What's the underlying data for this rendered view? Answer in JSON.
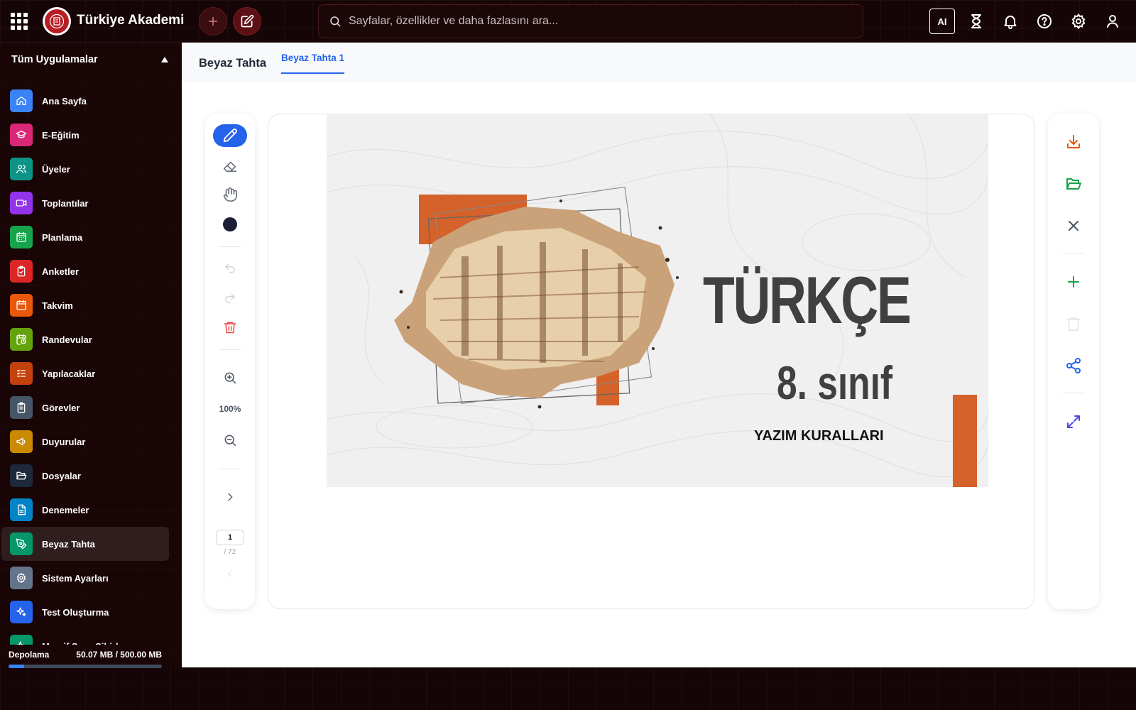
{
  "app": {
    "brand": "Türkiye Akademi"
  },
  "search": {
    "placeholder": "Sayfalar, özellikler ve daha fazlasını ara..."
  },
  "topbar": {
    "ai_label": "AI",
    "icons": [
      "hourglass-icon",
      "bell-icon",
      "help-icon",
      "settings-icon",
      "user-icon"
    ]
  },
  "sidebar": {
    "header": "Tüm Uygulamalar",
    "items": [
      {
        "label": "Ana Sayfa",
        "icon": "home-icon",
        "color": "#3b82f6"
      },
      {
        "label": "E-Eğitim",
        "icon": "graduation-cap-icon",
        "color": "#db2777"
      },
      {
        "label": "Üyeler",
        "icon": "users-icon",
        "color": "#0d9488"
      },
      {
        "label": "Toplantılar",
        "icon": "video-icon",
        "color": "#9333ea"
      },
      {
        "label": "Planlama",
        "icon": "calendar-grid-icon",
        "color": "#16a34a"
      },
      {
        "label": "Anketler",
        "icon": "clipboard-check-icon",
        "color": "#dc2626"
      },
      {
        "label": "Takvim",
        "icon": "calendar-icon",
        "color": "#ea580c"
      },
      {
        "label": "Randevular",
        "icon": "calendar-clock-icon",
        "color": "#65a30d"
      },
      {
        "label": "Yapılacaklar",
        "icon": "checklist-icon",
        "color": "#c2410c"
      },
      {
        "label": "Görevler",
        "icon": "clipboard-list-icon",
        "color": "#475569"
      },
      {
        "label": "Duyurular",
        "icon": "megaphone-icon",
        "color": "#ca8a04"
      },
      {
        "label": "Dosyalar",
        "icon": "folder-open-icon",
        "color": "#1e293b"
      },
      {
        "label": "Denemeler",
        "icon": "document-icon",
        "color": "#0284c7"
      },
      {
        "label": "Beyaz Tahta",
        "icon": "pen-tool-icon",
        "color": "#059669",
        "active": true
      },
      {
        "label": "Sistem Ayarları",
        "icon": "gear-icon",
        "color": "#64748b"
      },
      {
        "label": "Test Oluşturma",
        "icon": "sparkles-icon",
        "color": "#2563eb"
      },
      {
        "label": "Maarif Soru Sihirbazı",
        "icon": "sparkles-icon",
        "color": "#059669"
      }
    ],
    "storage": {
      "label": "Depolama",
      "value": "50.07 MB / 500.00 MB",
      "fraction": 0.1
    }
  },
  "main": {
    "title": "Beyaz Tahta",
    "tab": "Beyaz Tahta 1"
  },
  "whiteboard": {
    "zoom": "100%",
    "page": "1",
    "page_total": "/ 72",
    "pen_color": "#1a1f36",
    "slide": {
      "title": "TÜRKÇE",
      "grade": "8. sınıf",
      "subtitle": "YAZIM KURALLARI",
      "accent": "#d4622a"
    }
  }
}
